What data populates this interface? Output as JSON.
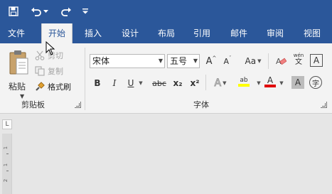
{
  "qat": {
    "save_icon": "save-icon",
    "undo_icon": "undo-icon",
    "redo_icon": "redo-icon",
    "customize_icon": "customize-qat-icon"
  },
  "tabs": [
    {
      "label": "文件"
    },
    {
      "label": "开始"
    },
    {
      "label": "插入"
    },
    {
      "label": "设计"
    },
    {
      "label": "布局"
    },
    {
      "label": "引用"
    },
    {
      "label": "邮件"
    },
    {
      "label": "审阅"
    },
    {
      "label": "视图"
    }
  ],
  "clipboard": {
    "paste_label": "粘贴",
    "cut_label": "剪切",
    "copy_label": "复制",
    "format_painter_label": "格式刷",
    "group_label": "剪贴板"
  },
  "font": {
    "font_name": "宋体",
    "font_size": "五号",
    "grow_font": "A",
    "shrink_font": "A",
    "change_case": "Aa",
    "clear_format": "A",
    "phonetic_top": "wén",
    "phonetic_bottom": "文",
    "char_border": "A",
    "bold": "B",
    "italic": "I",
    "underline": "U",
    "strikethrough": "abc",
    "subscript": "x₂",
    "superscript": "x²",
    "text_effects": "A",
    "highlight": "ab",
    "font_color": "A",
    "char_shading": "A",
    "enclose_char": "字",
    "group_label": "字体",
    "highlight_color": "#ffff00",
    "font_color_value": "#e00000"
  },
  "ruler": {
    "corner": "L",
    "marks": [
      "1",
      "1",
      "2"
    ]
  }
}
